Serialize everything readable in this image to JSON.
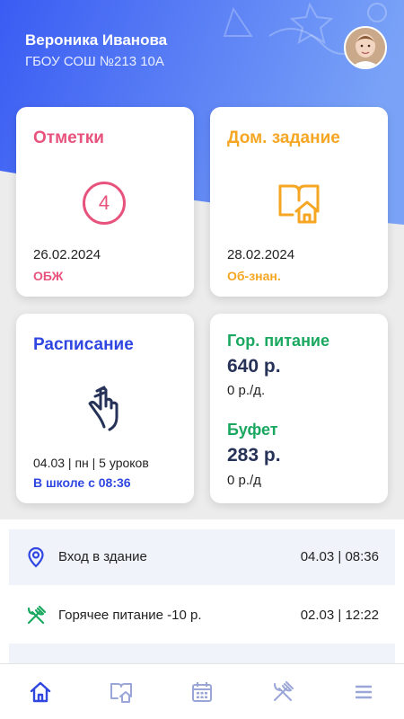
{
  "user": {
    "name": "Вероника Иванова",
    "school": "ГБОУ СОШ №213 10А"
  },
  "cards": {
    "grades": {
      "title": "Отметки",
      "grade": "4",
      "date": "26.02.2024",
      "subject": "ОБЖ",
      "color": "#e8537d"
    },
    "homework": {
      "title": "Дом. задание",
      "date": "28.02.2024",
      "subject": "Об-знан.",
      "color": "#f5a623"
    },
    "schedule": {
      "title": "Расписание",
      "info": "04.03 | пн | 5 уроков",
      "status": "В школе с 08:36",
      "color": "#2f47e0"
    },
    "food": {
      "city_title": "Гор. питание",
      "city_amount": "640 р.",
      "city_per_day": "0 р./д.",
      "buffet_title": "Буфет",
      "buffet_amount": "283 р.",
      "buffet_per_day": "0 р./д",
      "color": "#1aa860"
    }
  },
  "events": [
    {
      "icon": "location-pin-icon",
      "label": "Вход в здание",
      "time": "04.03 | 08:36"
    },
    {
      "icon": "fork-knife-icon",
      "label": "Горячее питание  -10 р.",
      "time": "02.03 | 12:22"
    }
  ],
  "nav": {
    "items": [
      {
        "icon": "home-icon",
        "active": true
      },
      {
        "icon": "homework-icon",
        "active": false
      },
      {
        "icon": "calendar-icon",
        "active": false
      },
      {
        "icon": "fork-knife-icon",
        "active": false
      },
      {
        "icon": "menu-icon",
        "active": false
      }
    ]
  },
  "colors": {
    "brand_blue": "#2f4cf0",
    "nav_active": "#2f47e0",
    "nav_inactive": "#9aa6d8"
  }
}
